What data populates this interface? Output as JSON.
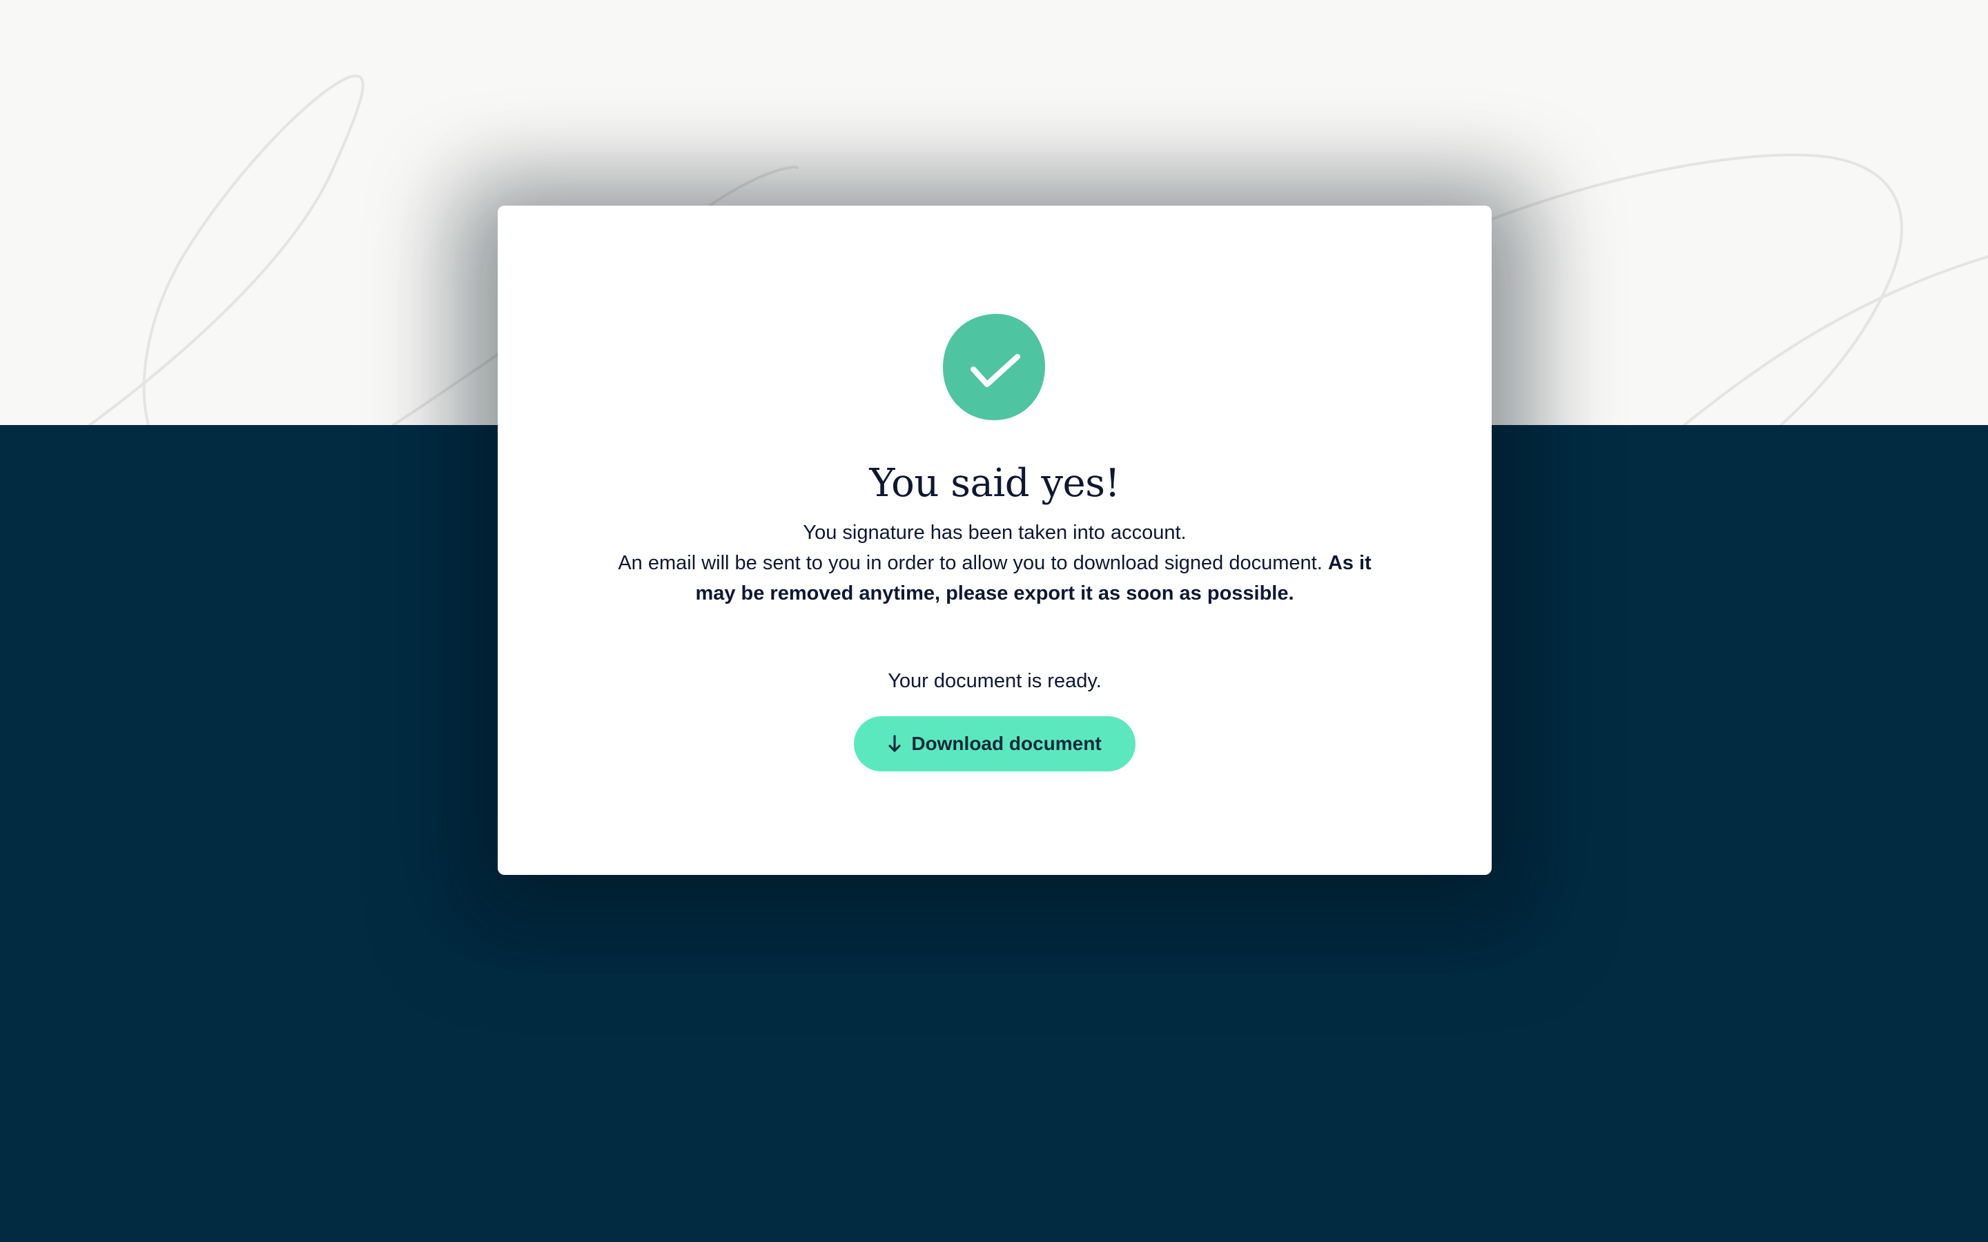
{
  "page": {
    "background_top": "#f8f8f6",
    "background_bottom": "#022b42"
  },
  "card": {
    "icon": "check-circle-icon",
    "icon_color": "#4fc4a1",
    "title": "You said yes!",
    "line1": "You signature has been taken into account.",
    "line2_regular": "An email will be sent to you in order to allow you to download signed document.",
    "line2_bold": "As it may be removed anytime, please export it as soon as possible.",
    "ready_text": "Your document is ready.",
    "download_label": "Download document",
    "download_icon": "arrow-down-icon",
    "button_color": "#5ce8bf"
  }
}
